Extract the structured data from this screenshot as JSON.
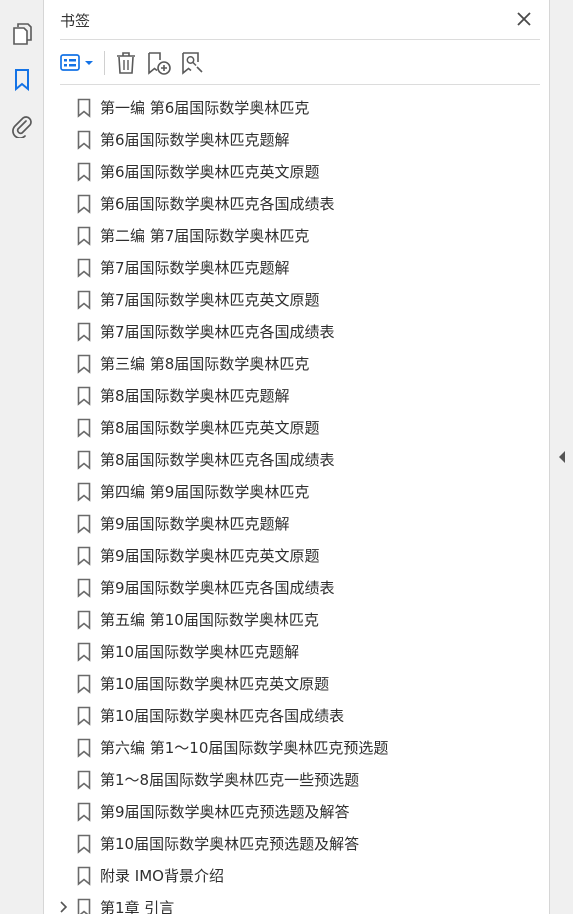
{
  "rail": {
    "icons": [
      "pages-icon",
      "bookmark-icon",
      "attachment-icon"
    ]
  },
  "panel": {
    "title": "书签",
    "toolbar": {
      "options_icon": "list-options-icon",
      "delete_icon": "trash-icon",
      "new_bookmark_icon": "bookmark-add-icon",
      "find_bookmark_icon": "bookmark-search-icon"
    }
  },
  "bookmarks": [
    "第一编  第6届国际数学奥林匹克",
    "第6届国际数学奥林匹克题解",
    "第6届国际数学奥林匹克英文原题",
    "第6届国际数学奥林匹克各国成绩表",
    "第二编  第7届国际数学奥林匹克",
    "第7届国际数学奥林匹克题解",
    "第7届国际数学奥林匹克英文原题",
    "第7届国际数学奥林匹克各国成绩表",
    "第三编  第8届国际数学奥林匹克",
    "第8届国际数学奥林匹克题解",
    "第8届国际数学奥林匹克英文原题",
    "第8届国际数学奥林匹克各国成绩表",
    "第四编  第9届国际数学奥林匹克",
    "第9届国际数学奥林匹克题解",
    "第9届国际数学奥林匹克英文原题",
    "第9届国际数学奥林匹克各国成绩表",
    "第五编  第10届国际数学奥林匹克",
    "第10届国际数学奥林匹克题解",
    "第10届国际数学奥林匹克英文原题",
    "第10届国际数学奥林匹克各国成绩表",
    "第六编  第1～10届国际数学奥林匹克预选题",
    "第1～8届国际数学奥林匹克一些预选题",
    "第9届国际数学奥林匹克预选题及解答",
    "第10届国际数学奥林匹克预选题及解答",
    "附录  IMO背景介绍",
    "第1章  引言"
  ],
  "colors": {
    "accent": "#1473e6",
    "icon_gray": "#5a5a5a",
    "rail_bg": "#f0f0f0"
  }
}
